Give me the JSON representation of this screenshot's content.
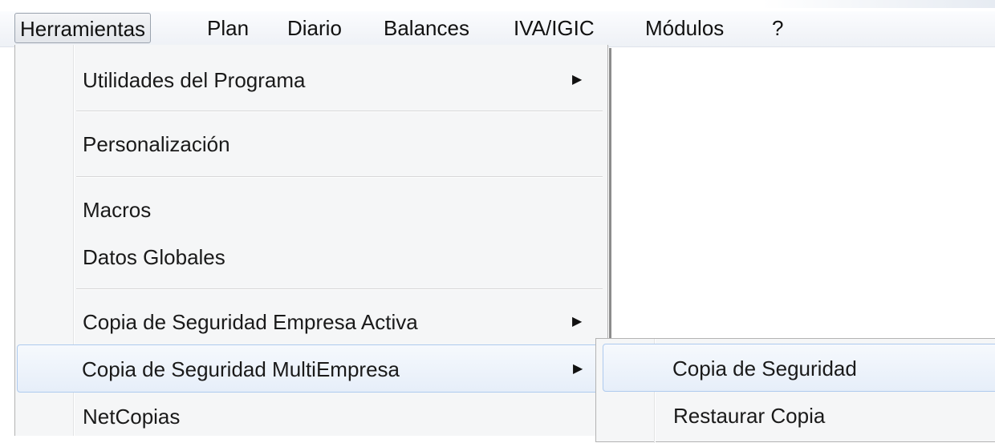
{
  "menubar": {
    "items": [
      {
        "label": "Herramientas"
      },
      {
        "label": "Plan"
      },
      {
        "label": "Diario"
      },
      {
        "label": "Balances"
      },
      {
        "label": "IVA/IGIC"
      },
      {
        "label": "Módulos"
      },
      {
        "label": "?"
      }
    ]
  },
  "menu": {
    "items": [
      {
        "label": "Utilidades del Programa"
      },
      {
        "label": "Personalización"
      },
      {
        "label": "Macros"
      },
      {
        "label": "Datos Globales"
      },
      {
        "label": "Copia de Seguridad Empresa Activa"
      },
      {
        "label": "Copia de Seguridad MultiEmpresa"
      },
      {
        "label": "NetCopias"
      }
    ]
  },
  "submenu": {
    "items": [
      {
        "label": "Copia de Seguridad"
      },
      {
        "label": "Restaurar Copia"
      }
    ]
  },
  "icons": {
    "submenu_arrow": "▶"
  }
}
